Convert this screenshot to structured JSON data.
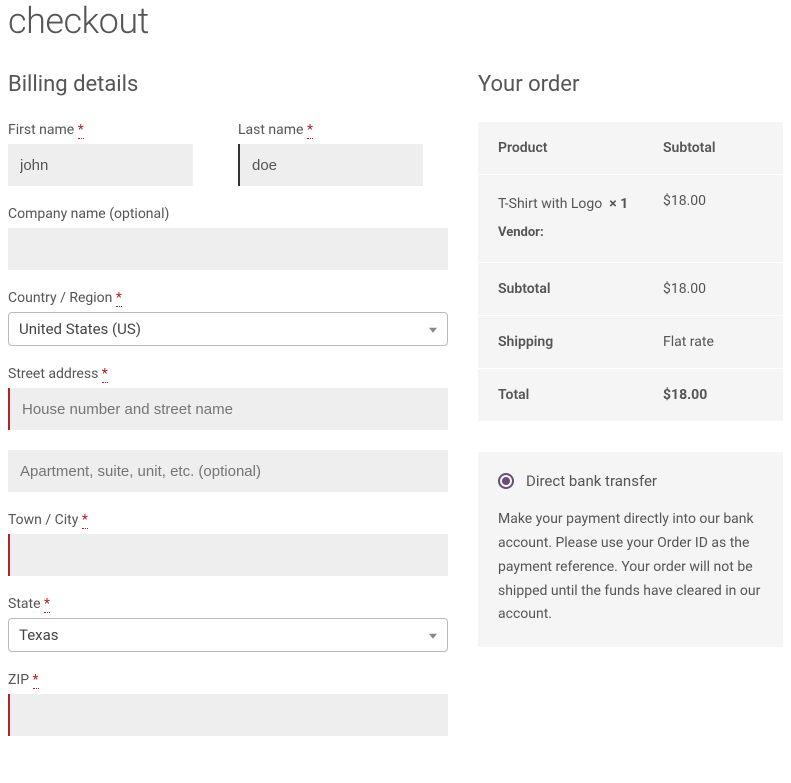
{
  "page_title": "checkout",
  "billing": {
    "heading": "Billing details",
    "required_mark": "*",
    "fields": {
      "first_name": {
        "label": "First name",
        "value": "john"
      },
      "last_name": {
        "label": "Last name",
        "value": "doe"
      },
      "company": {
        "label": "Company name (optional)",
        "value": ""
      },
      "country": {
        "label": "Country / Region",
        "value": "United States (US)"
      },
      "street": {
        "label": "Street address",
        "placeholder": "House number and street name",
        "value": ""
      },
      "street2": {
        "placeholder": "Apartment, suite, unit, etc. (optional)",
        "value": ""
      },
      "city": {
        "label": "Town / City",
        "value": ""
      },
      "state": {
        "label": "State",
        "value": "Texas"
      },
      "zip": {
        "label": "ZIP",
        "value": ""
      }
    }
  },
  "order": {
    "heading": "Your order",
    "headers": {
      "product": "Product",
      "subtotal": "Subtotal"
    },
    "items": [
      {
        "name": "T-Shirt with Logo",
        "qty": "× 1",
        "vendor_label": "Vendor:",
        "subtotal": "$18.00"
      }
    ],
    "footers": {
      "subtotal": {
        "label": "Subtotal",
        "value": "$18.00"
      },
      "shipping": {
        "label": "Shipping",
        "value": "Flat rate"
      },
      "total": {
        "label": "Total",
        "value": "$18.00"
      }
    }
  },
  "payment": {
    "option_label": "Direct bank transfer",
    "description": "Make your payment directly into our bank account. Please use your Order ID as the payment reference. Your order will not be shipped until the funds have cleared in our account."
  }
}
